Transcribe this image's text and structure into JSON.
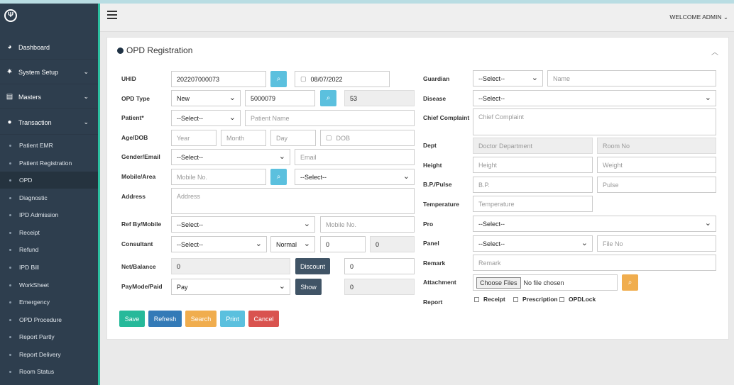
{
  "sidebar": {
    "logo": "Ψ",
    "menus": [
      {
        "label": "Dashboard",
        "icon": "dashboard-icon",
        "chevron": false
      },
      {
        "label": "System Setup",
        "icon": "gear-icon",
        "chevron": true
      },
      {
        "label": "Masters",
        "icon": "book-icon",
        "chevron": true
      },
      {
        "label": "Transaction",
        "icon": "user-icon",
        "chevron": true
      }
    ],
    "items": [
      "Patient EMR",
      "Patient Registration",
      "OPD",
      "Diagnostic",
      "IPD Admission",
      "Receipt",
      "Refund",
      "IPD Bill",
      "WorkSheet",
      "Emergency",
      "OPD Procedure",
      "Report Partly",
      "Report Delivery",
      "Room Status"
    ],
    "active": "OPD",
    "accent": "#2bbfa0"
  },
  "header": {
    "welcome": "WELCOME ADMIN"
  },
  "card": {
    "title": "OPD Registration"
  },
  "left": {
    "uhid_label": "UHID",
    "uhid_value": "202207000073",
    "date_value": "08/07/2022",
    "opd_type_label": "OPD Type",
    "opd_type_value": "New",
    "opd_no": "5000079",
    "opd_count": "53",
    "patient_label": "Patient*",
    "patient_select": "--Select--",
    "patient_name_ph": "Patient Name",
    "age_label": "Age/DOB",
    "year_ph": "Year",
    "month_ph": "Month",
    "day_ph": "Day",
    "dob_ph": "DOB",
    "gender_label": "Gender/Email",
    "gender_select": "--Select--",
    "email_ph": "Email",
    "mobile_label": "Mobile/Area",
    "mobile_ph": "Mobile No.",
    "area_select": "--Select--",
    "address_label": "Address",
    "address_ph": "Address",
    "refby_label": "Ref By/Mobile",
    "refby_select": "--Select--",
    "refby_mobile_ph": "Mobile No.",
    "consultant_label": "Consultant",
    "consultant_select": "--Select--",
    "priority_select": "Normal",
    "fee_value": "0",
    "fee_ro": "0",
    "net_label": "Net/Balance",
    "net_value": "0",
    "discount_label": "Discount",
    "discount_value": "0",
    "paymode_label": "PayMode/Paid",
    "paymode_select": "Pay",
    "show_label": "Show",
    "paid_value": "0"
  },
  "right": {
    "guardian_label": "Guardian",
    "guardian_select": "--Select--",
    "guardian_name_ph": "Name",
    "disease_label": "Disease",
    "disease_select": "--Select--",
    "complaint_label": "Chief Complaint",
    "complaint_ph": "Chief Complaint",
    "dept_label": "Dept",
    "dept_ph": "Doctor Department",
    "room_ph": "Room No",
    "height_label": "Height",
    "height_ph": "Height",
    "weight_ph": "Weight",
    "bp_label": "B.P./Pulse",
    "bp_ph": "B.P.",
    "pulse_ph": "Pulse",
    "temp_label": "Temperature",
    "temp_ph": "Temperature",
    "pro_label": "Pro",
    "pro_select": "--Select--",
    "panel_label": "Panel",
    "panel_select": "--Select--",
    "file_ph": "File No",
    "remark_label": "Remark",
    "remark_ph": "Remark",
    "attach_label": "Attachment",
    "choose_files": "Choose Files",
    "no_file": "No file chosen",
    "report_label": "Report",
    "cb_receipt": "Receipt",
    "cb_prescription": "Prescription",
    "cb_opdlock": "OPDLock"
  },
  "actions": [
    {
      "label": "Save",
      "color": "#26b99a"
    },
    {
      "label": "Refresh",
      "color": "#337ab7"
    },
    {
      "label": "Search",
      "color": "#f0ad4e"
    },
    {
      "label": "Print",
      "color": "#5bc0de"
    },
    {
      "label": "Cancel",
      "color": "#d9534f"
    }
  ]
}
